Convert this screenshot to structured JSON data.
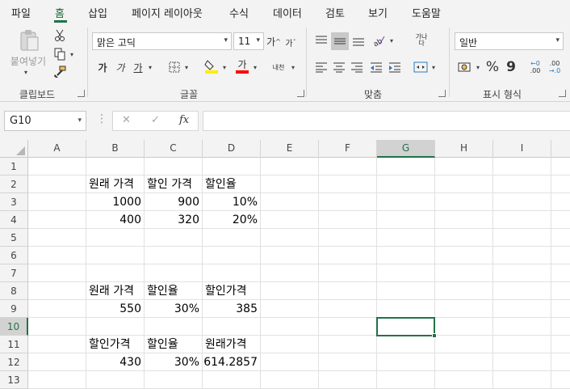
{
  "menu": {
    "tabs": [
      "파일",
      "홈",
      "삽입",
      "페이지 레이아웃",
      "수식",
      "데이터",
      "검토",
      "보기",
      "도움말"
    ],
    "active_tab": "홈"
  },
  "ribbon": {
    "clipboard": {
      "paste_label": "붙여넣기",
      "group_label": "클립보드"
    },
    "font": {
      "font_name": "맑은 고딕",
      "font_size": "11",
      "grow": "가",
      "shrink": "가",
      "bold": "가",
      "italic": "가",
      "underline": "가",
      "phonetic": "내천",
      "group_label": "글꼴",
      "highlight_color": "#ffee00",
      "font_color": "#ff0000"
    },
    "alignment": {
      "wrap_label": "가나다",
      "group_label": "맞춤"
    },
    "number": {
      "format": "일반",
      "group_label": "표시 형식",
      "percent": "%",
      "comma": "9",
      "inc_decimal": ".00",
      "dec_decimal": ".0"
    }
  },
  "formula_bar": {
    "name_box": "G10",
    "cancel_icon": "✕",
    "enter_icon": "✓",
    "fx_label": "fx",
    "formula": ""
  },
  "sheet": {
    "columns": [
      "A",
      "B",
      "C",
      "D",
      "E",
      "F",
      "G",
      "H",
      "I"
    ],
    "rows": [
      "1",
      "2",
      "3",
      "4",
      "5",
      "6",
      "7",
      "8",
      "9",
      "10",
      "11",
      "12",
      "13"
    ],
    "selected_column": "G",
    "selected_row": "10",
    "cells": {
      "B2": "원래 가격",
      "C2": "할인 가격",
      "D2": "할인율",
      "B3": "1000",
      "C3": "900",
      "D3": "10%",
      "B4": "400",
      "C4": "320",
      "D4": "20%",
      "B8": "원래 가격",
      "C8": "할인율",
      "D8": "할인가격",
      "B9": "550",
      "C9": "30%",
      "D9": "385",
      "B11": "할인가격",
      "C11": "할인율",
      "D11": "원래가격",
      "B12": "430",
      "C12": "30%",
      "D12": "614.2857"
    }
  }
}
